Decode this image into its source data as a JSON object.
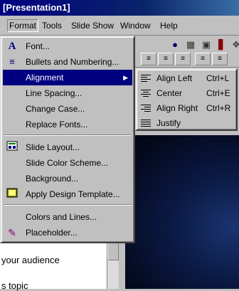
{
  "window": {
    "title": "[Presentation1]"
  },
  "menubar": {
    "items": [
      {
        "label": "Format",
        "open": true
      },
      {
        "label": "Tools"
      },
      {
        "label": "Slide Show"
      },
      {
        "label": "Window"
      },
      {
        "label": "Help"
      }
    ]
  },
  "format_menu": {
    "items": [
      {
        "label": "Font...",
        "icon": "font-A-icon"
      },
      {
        "label": "Bullets and Numbering...",
        "icon": "bullets-icon"
      },
      {
        "label": "Alignment",
        "highlighted": true,
        "submenu": true
      },
      {
        "label": "Line Spacing..."
      },
      {
        "label": "Change Case..."
      },
      {
        "label": "Replace Fonts..."
      },
      {
        "label": "Slide Layout...",
        "icon": "slide-layout-icon"
      },
      {
        "label": "Slide Color Scheme..."
      },
      {
        "label": "Background..."
      },
      {
        "label": "Apply Design Template...",
        "icon": "design-template-icon"
      },
      {
        "label": "Colors and Lines..."
      },
      {
        "label": "Placeholder...",
        "icon": "placeholder-icon"
      }
    ]
  },
  "alignment_submenu": {
    "items": [
      {
        "label": "Align Left",
        "shortcut": "Ctrl+L",
        "icon": "align-left-icon"
      },
      {
        "label": "Center",
        "shortcut": "Ctrl+E",
        "icon": "align-center-icon"
      },
      {
        "label": "Align Right",
        "shortcut": "Ctrl+R",
        "icon": "align-right-icon"
      },
      {
        "label": "Justify",
        "shortcut": "",
        "icon": "justify-icon"
      }
    ]
  },
  "outline_text": {
    "line1": "your audience",
    "line2": "s topic"
  },
  "colors": {
    "highlight": "#000080",
    "menu_bg": "#c0c0c0",
    "slide_bg": "#0b1a45"
  }
}
